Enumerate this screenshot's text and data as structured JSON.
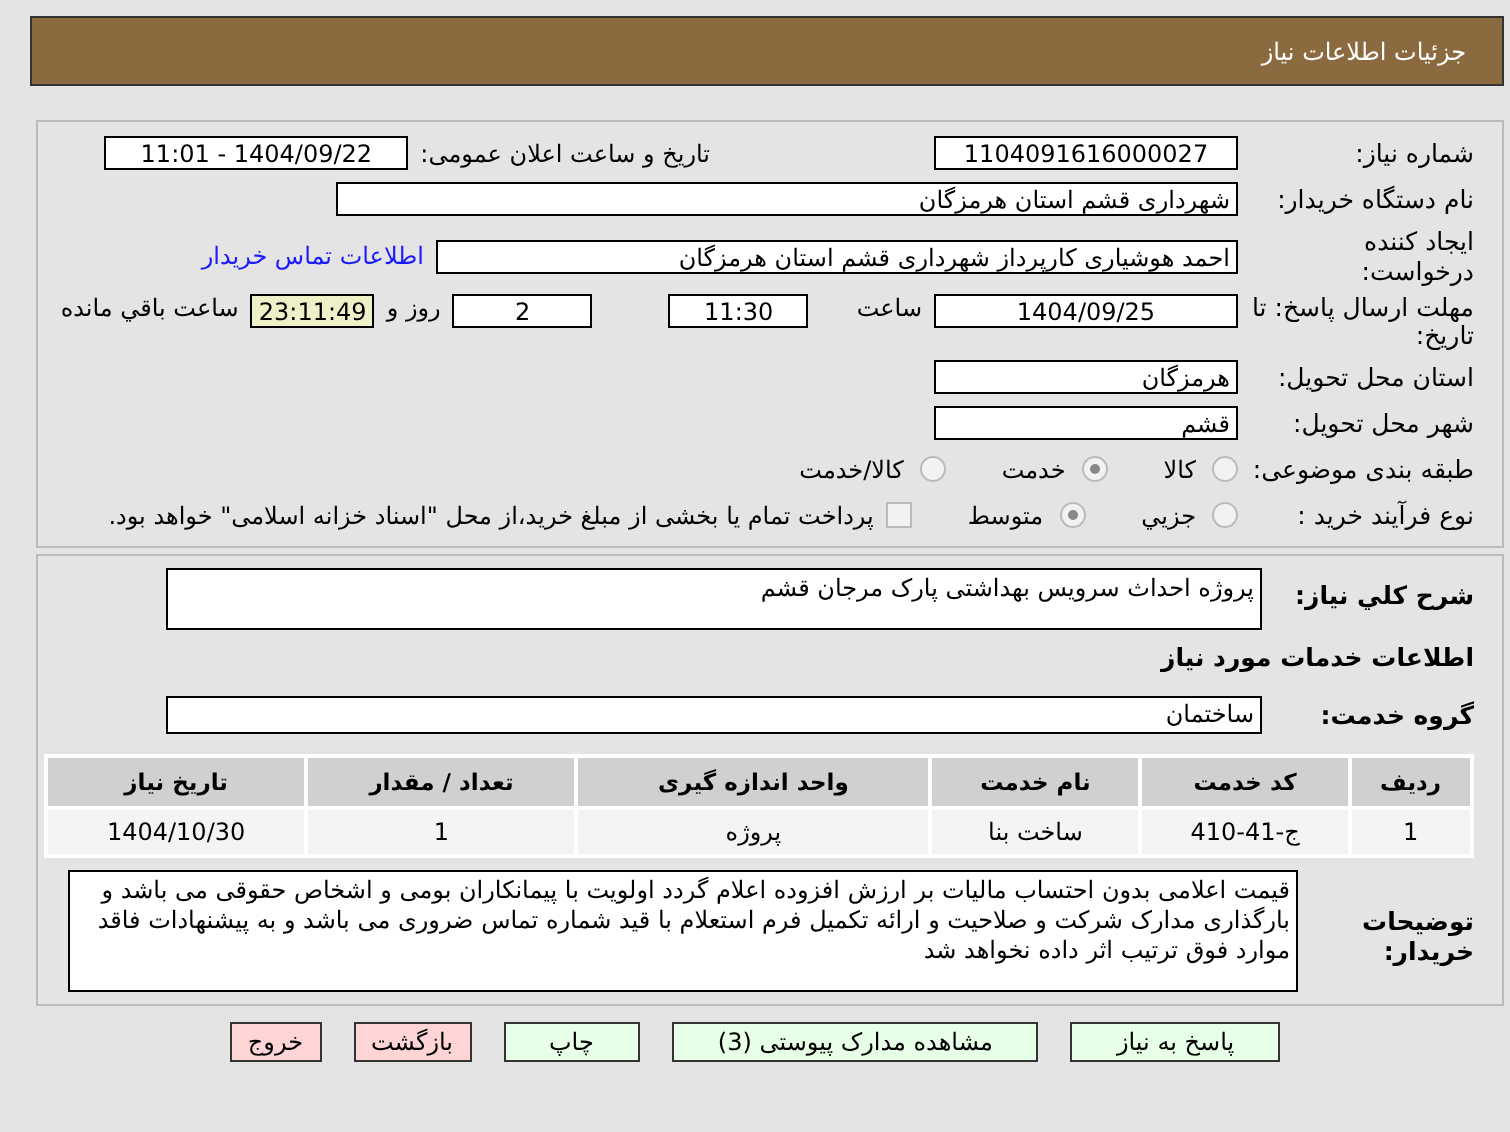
{
  "header": {
    "title": "جزئیات اطلاعات نیاز"
  },
  "details": {
    "need_number": {
      "label": "شماره نیاز:",
      "value": "1104091616000027"
    },
    "announce": {
      "label": "تاریخ و ساعت اعلان عمومی:",
      "value": "1404/09/22 - 11:01"
    },
    "buyer": {
      "label": "نام دستگاه خریدار:",
      "value": "شهرداری قشم استان هرمزگان"
    },
    "creator": {
      "label": "ایجاد کننده درخواست:",
      "value": "احمد هوشیاری کارپرداز شهرداری قشم استان هرمزگان",
      "link": "اطلاعات تماس خریدار"
    },
    "deadline": {
      "label": "مهلت ارسال پاسخ: تا تاریخ:",
      "date": "1404/09/25",
      "time_label": "ساعت",
      "time": "11:30",
      "days": "2",
      "days_label": "روز و",
      "remaining": "23:11:49",
      "remaining_label": "ساعت باقي مانده"
    },
    "province": {
      "label": "استان محل تحویل:",
      "value": "هرمزگان"
    },
    "city": {
      "label": "شهر محل تحویل:",
      "value": "قشم"
    },
    "category": {
      "label": "طبقه بندی موضوعی:",
      "options": [
        {
          "label": "کالا",
          "selected": false
        },
        {
          "label": "خدمت",
          "selected": true
        },
        {
          "label": "کالا/خدمت",
          "selected": false
        }
      ]
    },
    "process": {
      "label": "نوع فرآیند خرید :",
      "options": [
        {
          "label": "جزيي",
          "selected": false
        },
        {
          "label": "متوسط",
          "selected": true
        }
      ],
      "payment": {
        "checked": false,
        "label": "پرداخت تمام یا بخشی از مبلغ خرید،از محل \"اسناد خزانه اسلامی\" خواهد بود."
      }
    }
  },
  "summary": {
    "label": "شرح کلي نیاز:",
    "value": "پروژه احداث سرویس بهداشتی پارک مرجان قشم"
  },
  "services_heading": "اطلاعات خدمات مورد نیاز",
  "service_group": {
    "label": "گروه خدمت:",
    "value": "ساختمان"
  },
  "table": {
    "columns": [
      "ردیف",
      "کد خدمت",
      "نام خدمت",
      "واحد اندازه گیری",
      "تعداد / مقدار",
      "تاریخ نیاز"
    ],
    "rows": [
      [
        "1",
        "ج-41-410",
        "ساخت بنا",
        "پروژه",
        "1",
        "1404/10/30"
      ]
    ]
  },
  "notes": {
    "label": "توضیحات خریدار:",
    "value": "قیمت اعلامی بدون احتساب مالیات بر ارزش افزوده اعلام گردد اولویت با پیمانکاران بومی و اشخاص حقوقی می باشد و بارگذاری مدارک شرکت و صلاحیت و ارائه تکمیل فرم استعلام با قید شماره تماس ضروری می باشد و به پیشنهادات فاقد موارد فوق ترتیب اثر داده نخواهد شد"
  },
  "buttons": [
    {
      "label": "پاسخ به نیاز",
      "kind": "primary"
    },
    {
      "label": "مشاهده مدارک پیوستی (3)",
      "kind": "primary"
    },
    {
      "label": "چاپ",
      "kind": "primary"
    },
    {
      "label": "بازگشت",
      "kind": "danger"
    },
    {
      "label": "خروج",
      "kind": "danger"
    }
  ]
}
